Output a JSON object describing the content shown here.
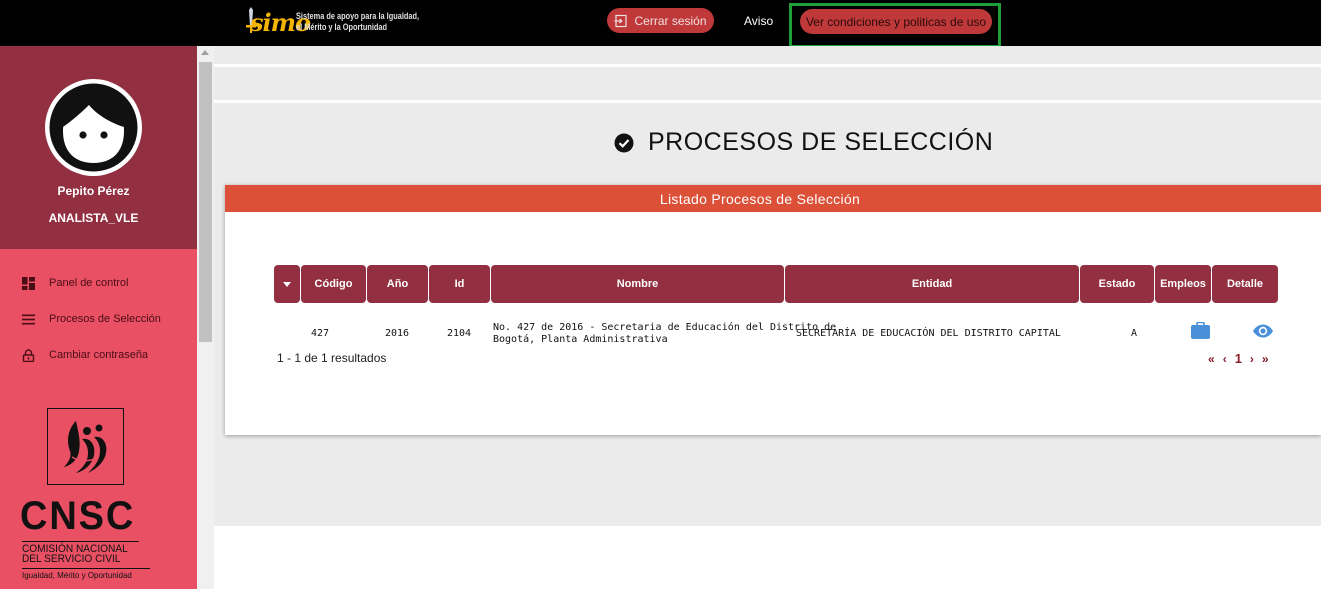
{
  "header": {
    "logo_word": "simo",
    "logo_tagline_1": "Sistema de apoyo para la Igualdad,",
    "logo_tagline_2": "el Mérito y la Oportunidad",
    "logout_label": "Cerrar sesión",
    "aviso_label": "Aviso",
    "policies_label": "Ver condiciones y politicas de uso"
  },
  "sidebar": {
    "user_name": "Pepito Pérez",
    "user_role": "ANALISTA_VLE",
    "items": [
      {
        "label": "Panel de control",
        "icon": "dashboard-icon"
      },
      {
        "label": "Procesos de Selección",
        "icon": "list-icon"
      },
      {
        "label": "Cambiar contraseña",
        "icon": "lock-icon"
      }
    ],
    "org_logo": {
      "acronym": "CNSC",
      "line1": "COMISIÓN NACIONAL",
      "line2": "DEL SERVICIO CIVIL",
      "slogan": "Igualdad, Mérito y Oportunidad"
    }
  },
  "main": {
    "page_title": "PROCESOS DE SELECCIÓN",
    "card_title": "Listado Procesos de Selección",
    "columns": [
      "Código",
      "Año",
      "Id",
      "Nombre",
      "Entidad",
      "Estado",
      "Empleos",
      "Detalle"
    ],
    "rows": [
      {
        "codigo": "427",
        "anio": "2016",
        "id": "2104",
        "nombre_1": "No. 427 de 2016 - Secretaria de Educación del Distrito de",
        "nombre_2": "Bogotá, Planta Administrativa",
        "entidad": "SECRETARÍA DE EDUCACIÓN DEL DISTRITO CAPITAL",
        "estado": "A"
      }
    ],
    "results_text": "1 - 1 de 1 resultados",
    "pager": {
      "first": "«",
      "prev": "‹",
      "page": "1",
      "next": "›",
      "last": "»"
    }
  },
  "colors": {
    "topbar": "#000000",
    "sidebar": "#e95064",
    "sidebar_top": "#922f40",
    "header_cell": "#922f40",
    "card_header": "#dc5038",
    "button": "#c0393a",
    "highlight": "#1e9e35",
    "icon_blue": "#4a90d9"
  }
}
